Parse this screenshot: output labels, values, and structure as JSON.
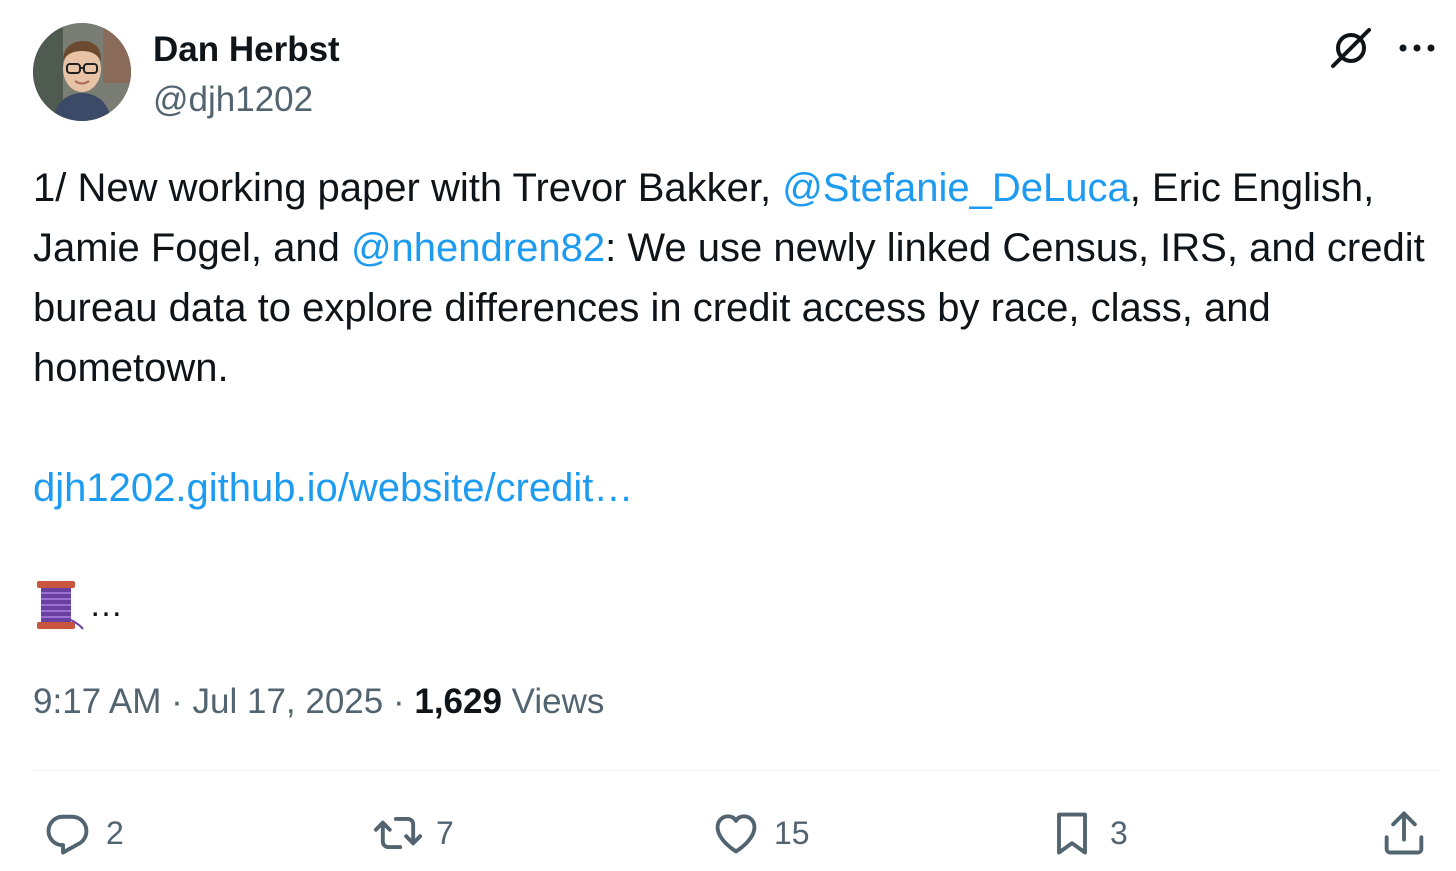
{
  "author": {
    "name": "Dan Herbst",
    "handle": "@djh1202"
  },
  "tweet": {
    "intro": "1/ New working paper with Trevor Bakker, ",
    "mention1": "@Stefanie_DeLuca",
    "mid1": ", Eric English, Jamie Fogel, and ",
    "mention2": "@nhendren82",
    "mid2": ": We use newly linked Census, IRS, and credit bureau data to explore differences in credit access by race, class, and hometown.",
    "link": "djh1202.github.io/website/credit…",
    "thread_emoji": "spool-of-thread",
    "thread_suffix": "…"
  },
  "meta": {
    "time": "9:17 AM",
    "separator1": " · ",
    "date": "Jul 17, 2025",
    "separator2": " · ",
    "views_count": "1,629",
    "views_label": " Views"
  },
  "actions": {
    "replies": "2",
    "retweets": "7",
    "likes": "15",
    "bookmarks": "3"
  },
  "icons": {
    "top_right": [
      "grok-icon",
      "more-icon"
    ],
    "actions": [
      "reply-icon",
      "retweet-icon",
      "like-icon",
      "bookmark-icon",
      "share-icon"
    ]
  },
  "colors": {
    "link": "#1d9bf0",
    "text": "#0f1419",
    "secondary": "#536471"
  }
}
